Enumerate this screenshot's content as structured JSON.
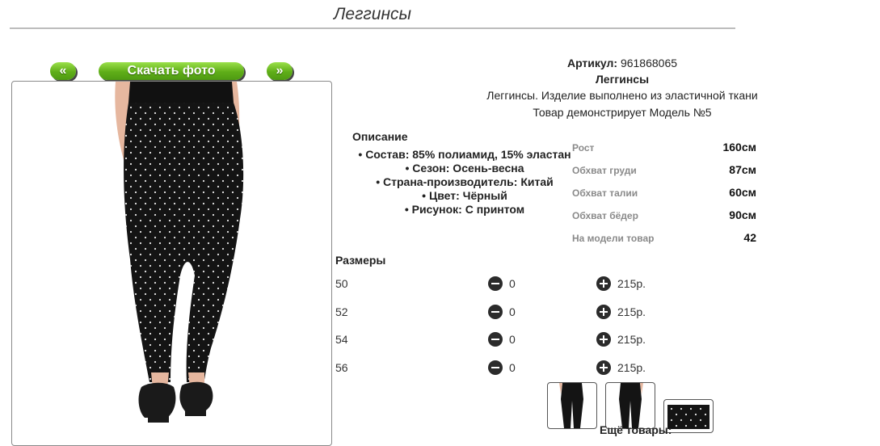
{
  "page": {
    "title": "Леггинсы"
  },
  "nav": {
    "prev": "«",
    "download": "Скачать фото",
    "next": "»"
  },
  "product": {
    "article_label": "Артикул:",
    "article_value": "961868065",
    "name": "Леггинсы",
    "summary": "Леггинсы. Изделие выполнено из эластичной ткани",
    "model_note": "Товар демонстрирует Модель №5"
  },
  "description": {
    "heading": "Описание",
    "items": [
      "Состав: 85% полиамид, 15% эластан",
      "Сезон: Осень-весна",
      "Страна-производитель: Китай",
      "Цвет: Чёрный",
      "Рисунок: С принтом"
    ]
  },
  "model": {
    "rows": [
      {
        "label": "Рост",
        "value": "160см"
      },
      {
        "label": "Обхват груди",
        "value": "87см"
      },
      {
        "label": "Обхват талии",
        "value": "60см"
      },
      {
        "label": "Обхват бёдер",
        "value": "90см"
      },
      {
        "label": "На модели товар",
        "value": "42"
      }
    ]
  },
  "sizes": {
    "heading": "Размеры",
    "rows": [
      {
        "size": "50",
        "qty": "0",
        "price": "215р."
      },
      {
        "size": "52",
        "qty": "0",
        "price": "215р."
      },
      {
        "size": "54",
        "qty": "0",
        "price": "215р."
      },
      {
        "size": "56",
        "qty": "0",
        "price": "215р."
      }
    ]
  },
  "more": {
    "label": "Ещё товары:"
  },
  "colors": {
    "button_green": "#5fae18",
    "product_black": "#111111",
    "heel_black": "#1a1a1a"
  }
}
